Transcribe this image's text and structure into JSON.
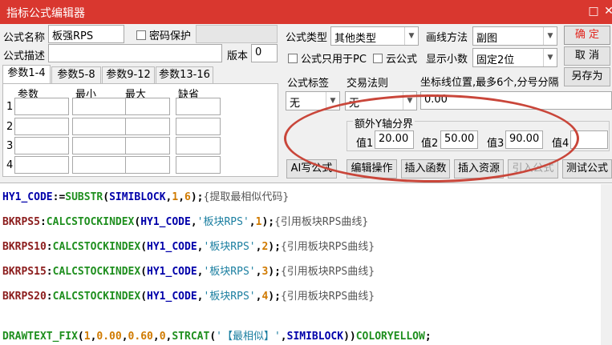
{
  "window": {
    "title": "指标公式编辑器",
    "minimize": "□",
    "close": "✕"
  },
  "form": {
    "name_label": "公式名称",
    "name_value": "板强RPS",
    "password_label": "密码保护",
    "desc_label": "公式描述",
    "desc_value": "",
    "version_label": "版本",
    "version_value": "0",
    "type_label": "公式类型",
    "type_value": "其他类型",
    "draw_label": "画线方法",
    "draw_value": "副图",
    "pc_only_label": "公式只用于PC",
    "cloud_label": "云公式",
    "decimals_label": "显示小数",
    "decimals_value": "固定2位",
    "tag_label": "公式标签",
    "tag_value": "无",
    "trade_label": "交易法则",
    "trade_value": "无",
    "coord_label": "坐标线位置,最多6个,分号分隔",
    "coord_value": "0.00"
  },
  "y_axis": {
    "title": "额外Y轴分界",
    "v1_label": "值1",
    "v1": "20.00",
    "v2_label": "值2",
    "v2": "50.00",
    "v3_label": "值3",
    "v3": "90.00",
    "v4_label": "值4",
    "v4": ""
  },
  "buttons": {
    "ok": "确 定",
    "cancel": "取 消",
    "save_as": "另存为",
    "ai_write": "AI写公式",
    "edit_op": "编辑操作",
    "insert_fn": "插入函数",
    "insert_res": "插入资源",
    "import_formula": "引入公式",
    "test_formula": "测试公式"
  },
  "tabs": [
    "参数1-4",
    "参数5-8",
    "参数9-12",
    "参数13-16"
  ],
  "params": {
    "headers": [
      "参数",
      "最小",
      "最大",
      "缺省"
    ],
    "rows": [
      "1",
      "2",
      "3",
      "4"
    ]
  },
  "code": [
    "HY1_CODE:=SUBSTR(SIMIBLOCK,1,6);{提取最相似代码}",
    "BKRPS5:CALCSTOCKINDEX(HY1_CODE,'板块RPS',1);{引用板块RPS曲线}",
    "BKRPS10:CALCSTOCKINDEX(HY1_CODE,'板块RPS',2);{引用板块RPS曲线}",
    "BKRPS15:CALCSTOCKINDEX(HY1_CODE,'板块RPS',3);{引用板块RPS曲线}",
    "BKRPS20:CALCSTOCKINDEX(HY1_CODE,'板块RPS',4);{引用板块RPS曲线}",
    "DRAWTEXT_FIX(1,0.00,0.60,0,STRCAT('【最相似】',SIMIBLOCK))COLORYELLOW;"
  ],
  "colors": {
    "titlebar": "#d9372f",
    "accent_red": "#e2261e",
    "annotation_circle": "#c9463a"
  }
}
